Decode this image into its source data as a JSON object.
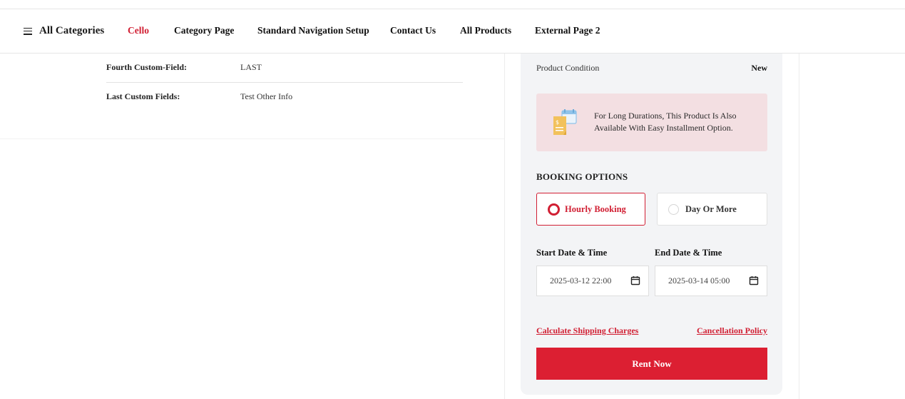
{
  "nav": {
    "all_categories": "All Categories",
    "items": [
      "Cello",
      "Category Page",
      "Standard Navigation Setup",
      "Contact Us",
      "All Products",
      "External Page 2"
    ],
    "active_item": "Cello"
  },
  "specs": [
    {
      "label": "Fourth Custom-Field:",
      "value": "LAST"
    },
    {
      "label": "Last Custom Fields:",
      "value": "Test Other Info"
    }
  ],
  "product": {
    "condition_label": "Product Condition",
    "condition_value": "New",
    "installment_notice": "For Long Durations, This Product Is Also Available With Easy Installment Option."
  },
  "booking": {
    "title": "BOOKING OPTIONS",
    "options": [
      "Hourly Booking",
      "Day Or More"
    ],
    "selected": "Hourly Booking",
    "start_label": "Start Date & Time",
    "start_value": "2025-03-12 22:00",
    "end_label": "End Date & Time",
    "end_value": "2025-03-14 05:00"
  },
  "links": {
    "shipping": "Calculate Shipping Charges",
    "cancellation": "Cancellation Policy"
  },
  "cta": {
    "rent_now": "Rent Now"
  },
  "colors": {
    "accent": "#dc1f32",
    "panel_bg": "#f3f4f6",
    "notice_bg": "#f3dfe2"
  }
}
